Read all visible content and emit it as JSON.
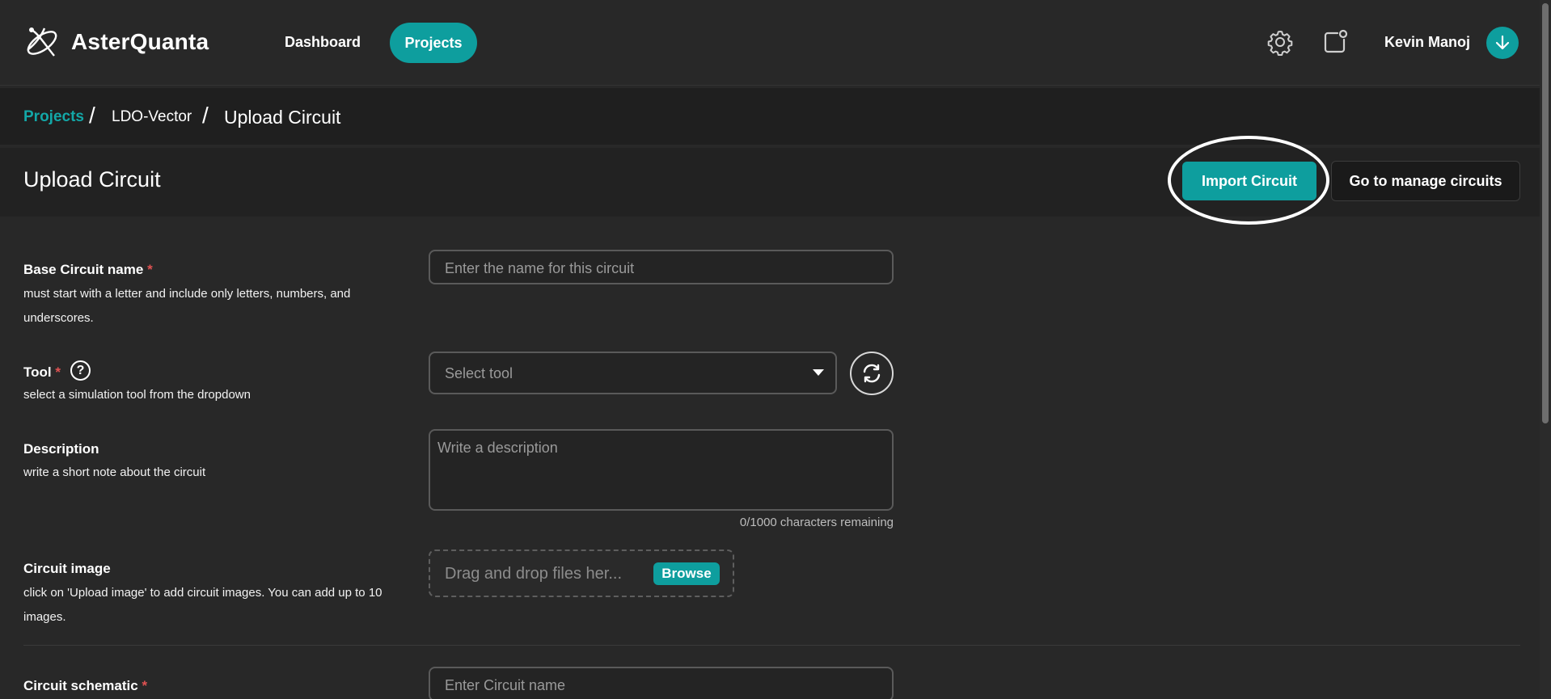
{
  "header": {
    "brand": "AsterQuanta",
    "nav": {
      "dashboard": "Dashboard",
      "projects": "Projects"
    },
    "user": "Kevin Manoj",
    "icons": [
      "logo-icon",
      "gear-icon",
      "notification-icon",
      "download-icon"
    ],
    "accent": "#0e9e9e"
  },
  "breadcrumb": {
    "items": [
      "Projects",
      "LDO-Vector",
      "Upload Circuit"
    ],
    "separator": "/"
  },
  "page": {
    "title": "Upload Circuit",
    "import_label": "Import Circuit",
    "manage_label": "Go to manage circuits"
  },
  "form": {
    "base_name": {
      "label": "Base Circuit name",
      "required": "*",
      "help": "must start with a letter and include only letters, numbers, and underscores.",
      "placeholder": "Enter the name for this circuit"
    },
    "tool": {
      "label": "Tool",
      "required": "*",
      "help_icon": "?",
      "help": "select a simulation tool from the dropdown",
      "placeholder": "Select tool"
    },
    "description": {
      "label": "Description",
      "help": "write a short note about the circuit",
      "placeholder": "Write a description",
      "counter": "0/1000 characters remaining"
    },
    "image": {
      "label": "Circuit image",
      "help": "click on 'Upload image' to add circuit images. You can add up to 10 images.",
      "dropzone_text": "Drag and drop files her...",
      "browse_label": "Browse"
    },
    "schematic": {
      "label": "Circuit schematic",
      "required": "*",
      "placeholder": "Enter Circuit name"
    }
  }
}
